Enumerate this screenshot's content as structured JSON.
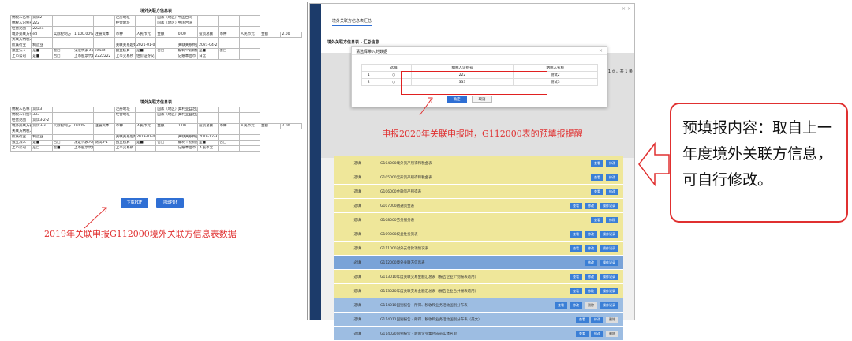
{
  "left_panel": {
    "report1": {
      "title": "境外关联方信息表",
      "rows": [
        [
          "纳税人名称",
          "测试2",
          "",
          "",
          "",
          "注册地址",
          "",
          "国家（地区）",
          "中国台湾",
          "",
          "",
          ""
        ],
        [
          "纳税人识别号",
          "222",
          "",
          "",
          "",
          "经营地址",
          "",
          "国家（地区）",
          "中国台湾",
          "",
          "",
          ""
        ],
        [
          "经营范围",
          "222ee",
          "",
          "",
          "",
          "",
          "",
          "",
          "",
          "",
          "",
          ""
        ],
        [
          "境外关联方各境外关联方地区组织",
          "ed",
          "实际控制方",
          "1,100.00%",
          "注册资本",
          "币种",
          "人民币元",
          "金额",
          "0.00",
          "投资总额",
          "币种",
          "人民币元",
          "金额",
          "2.00"
        ],
        [
          "关联方纳税人的实际控制方",
          "",
          "",
          "",
          "",
          "",
          "",
          "",
          "",
          "",
          "",
          ""
        ],
        [
          "所属行业",
          "制造业",
          "",
          "",
          "",
          "关联关系起始日期",
          "2021-01-01",
          "",
          "关联关系终止日期",
          "2021-04-21",
          "",
          ""
        ],
        [
          "独立法人",
          "是■",
          "否□",
          "法定代表人或负责人",
          "sdasd",
          "独立核算",
          "是■",
          "否□",
          "编制个别财务报表",
          "是■",
          "否□",
          ""
        ],
        [
          "上市公司",
          "是■",
          "否□",
          "上市股票代码",
          "2222222",
          "上市交易所",
          "估价证券交易所",
          "",
          "记账本位币",
          "日元",
          "",
          ""
        ]
      ]
    },
    "report2": {
      "title": "境外关联方信息表",
      "rows": [
        [
          "纳税人名称",
          "测试3",
          "",
          "",
          "",
          "注册地址",
          "",
          "国家（地区）",
          "奥利亚自治国",
          "",
          "",
          ""
        ],
        [
          "纳税人识别号",
          "333",
          "",
          "",
          "",
          "经营地址",
          "",
          "国家（地区）",
          "奥利亚自治国",
          "",
          "",
          ""
        ],
        [
          "经营范围",
          "测试3-2-2",
          "",
          "",
          "",
          "",
          "",
          "",
          "",
          "",
          "",
          ""
        ],
        [
          "境外关联方各境外关联方地区组织",
          "测试3-3",
          "实际控制方",
          "0.00%",
          "注册资本",
          "币种",
          "人民币元",
          "金额",
          "1.00",
          "投资总额",
          "币种",
          "人民币元",
          "金额",
          "2.00"
        ],
        [
          "关联方纳税人的实际控制方",
          "",
          "",
          "",
          "",
          "",
          "",
          "",
          "",
          "",
          "",
          ""
        ],
        [
          "所属行业",
          "制造业",
          "",
          "",
          "",
          "关联关系起始日期",
          "2019-01-01",
          "",
          "关联关系终止日期",
          "2019-12-31",
          "",
          ""
        ],
        [
          "独立法人",
          "是■",
          "否□",
          "法定代表人或负责人",
          "测试3-1",
          "独立核算",
          "是■",
          "否□",
          "编制个别财务报表",
          "是■",
          "否□",
          ""
        ],
        [
          "上市公司",
          "是□",
          "否■",
          "上市股票代码",
          "",
          "上市交易所",
          "",
          "",
          "记账本位币",
          "人民币元",
          "",
          ""
        ]
      ]
    },
    "buttons": {
      "download": "下载PDF",
      "export": "导出PDF"
    },
    "caption": "2019年关联申报G112000境外关联方信息表数据"
  },
  "right_panel": {
    "tab": "境外关联方信息表汇总",
    "subtitle": "境外关联方信息表 - 汇总信息",
    "paging": "第 1 页，共 1 条",
    "modal": {
      "title": "请选择带入的数据",
      "headers": [
        "",
        "选择",
        "纳税人识别号",
        "纳税人名称"
      ],
      "rows": [
        [
          "1",
          "○",
          "222",
          "测试2"
        ],
        [
          "2",
          "○",
          "333",
          "测试3"
        ]
      ],
      "confirm": "确定",
      "cancel": "取消"
    },
    "caption": "申报2020年关联申报时，G112000表的预填报提醒",
    "rows": [
      {
        "status": "选填",
        "name": "G104000境外资产所得和税金表",
        "btns": [
          "查看",
          "修改"
        ],
        "color": "yellow"
      },
      {
        "status": "选填",
        "name": "G105000无形资产所得和税金表",
        "btns": [
          "查看",
          "修改"
        ],
        "color": "yellow"
      },
      {
        "status": "选填",
        "name": "G106000金融资产所得表",
        "btns": [
          "查看",
          "修改"
        ],
        "color": "yellow"
      },
      {
        "status": "选填",
        "name": "G107000融通资金表",
        "btns": [
          "查看",
          "修改",
          "操作记录"
        ],
        "color": "yellow"
      },
      {
        "status": "选填",
        "name": "G108000劳务服务表",
        "btns": [
          "查看",
          "修改"
        ],
        "color": "yellow"
      },
      {
        "status": "选填",
        "name": "G109000权益性投资表",
        "btns": [
          "查看",
          "修改",
          "操作记录"
        ],
        "color": "yellow"
      },
      {
        "status": "选填",
        "name": "G111000对外支付款项情况表",
        "btns": [
          "查看",
          "修改",
          "操作记录"
        ],
        "color": "yellow"
      },
      {
        "status": "必填",
        "name": "G112000境外关联方信息表",
        "btns": [
          "修改",
          "操作记录"
        ],
        "color": "sel"
      },
      {
        "status": "选填",
        "name": "G113010年度关联交易金额汇总表（报告企业个别报表适用）",
        "btns": [
          "查看",
          "修改",
          "操作记录"
        ],
        "color": "yellow"
      },
      {
        "status": "选填",
        "name": "G113020年度关联交易金额汇总表（报告企业合并报表适用）",
        "btns": [
          "查看",
          "修改",
          "操作记录"
        ],
        "color": "yellow"
      },
      {
        "status": "选填",
        "name": "G114010国别报告 - 所得、税收和业务活动国别分布表",
        "btns": [
          "查看",
          "修改",
          "删除",
          "操作记录"
        ],
        "color": "blue"
      },
      {
        "status": "选填",
        "name": "G114011国别报告 - 所得、税收和业务活动国别分布表（英文）",
        "btns": [
          "查看",
          "修改",
          "删除"
        ],
        "color": "blue"
      },
      {
        "status": "选填",
        "name": "G114020国别报告 - 跨国企业集团成员实体名单",
        "btns": [
          "查看",
          "修改",
          "删除"
        ],
        "color": "blue"
      }
    ]
  },
  "callout": {
    "text": "预填报内容：取自上一年度境外关联方信息，可自行修改。"
  },
  "colors": {
    "accent": "#2f6fd4",
    "annotation_red": "#e03030",
    "row_yellow": "#efe79a",
    "row_blue": "#9dbde2"
  }
}
